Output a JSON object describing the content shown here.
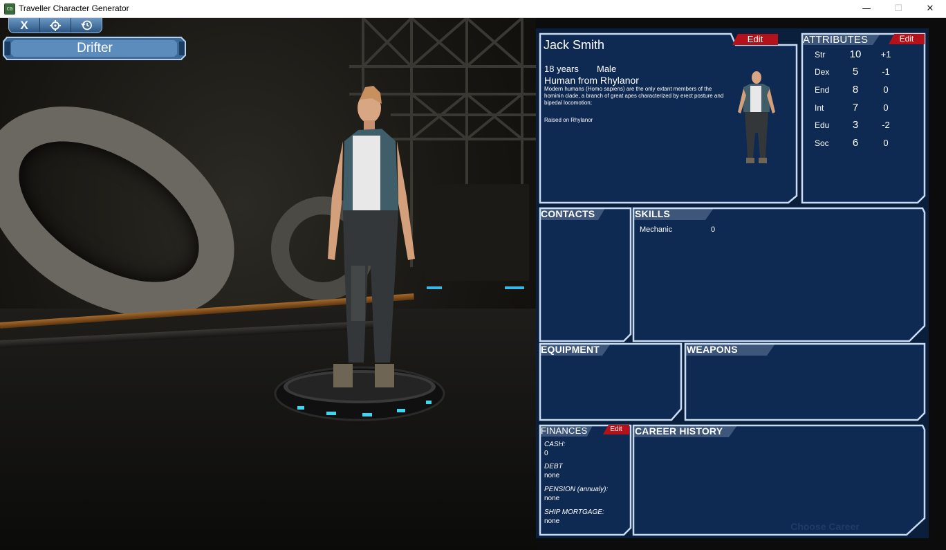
{
  "window": {
    "title": "Traveller Character Generator",
    "app_icon": "CG",
    "minimize": "—",
    "maximize": "☐",
    "close": "✕"
  },
  "toolbar": {
    "close_label": "X",
    "settings_icon": "gear-icon",
    "history_icon": "history-icon"
  },
  "character_type": "Drifter",
  "character": {
    "name": "Jack Smith",
    "age": "18 years",
    "gender": "Male",
    "species_line": "Human from Rhylanor",
    "description": "Modern humans (Homo sapiens) are the only extant members of the hominin clade, a branch of great apes characterized by erect posture and bipedal locomotion;",
    "raised": "Raised on Rhylanor",
    "edit_label": "Edit"
  },
  "attributes": {
    "title": "ATTRIBUTES",
    "edit_label": "Edit",
    "rows": [
      {
        "name": "Str",
        "value": "10",
        "mod": "+1"
      },
      {
        "name": "Dex",
        "value": "5",
        "mod": "-1"
      },
      {
        "name": "End",
        "value": "8",
        "mod": "0"
      },
      {
        "name": "Int",
        "value": "7",
        "mod": "0"
      },
      {
        "name": "Edu",
        "value": "3",
        "mod": "-2"
      },
      {
        "name": "Soc",
        "value": "6",
        "mod": "0"
      }
    ]
  },
  "contacts": {
    "title": "CONTACTS"
  },
  "skills": {
    "title": "SKILLS",
    "rows": [
      {
        "name": "Mechanic",
        "level": "0"
      }
    ]
  },
  "equipment": {
    "title": "EQUIPMENT"
  },
  "weapons": {
    "title": "WEAPONS"
  },
  "finances": {
    "title": "FINANCES",
    "edit_label": "Edit",
    "cash_label": "CASH:",
    "cash_value": "0",
    "debt_label": "DEBT",
    "debt_value": "none",
    "pension_label": "PENSION (annualy):",
    "pension_value": "none",
    "mortgage_label": "SHIP MORTGAGE:",
    "mortgage_value": "none"
  },
  "career_history": {
    "title": "CAREER HISTORY",
    "choose_button": "Choose Career"
  },
  "colors": {
    "sheet_bg": "#0a1f3c",
    "panel_bg": "#0f2a52",
    "frame": "#c8dcf4",
    "edit_red": "#b4121a",
    "accent_blue": "#2b5683"
  }
}
